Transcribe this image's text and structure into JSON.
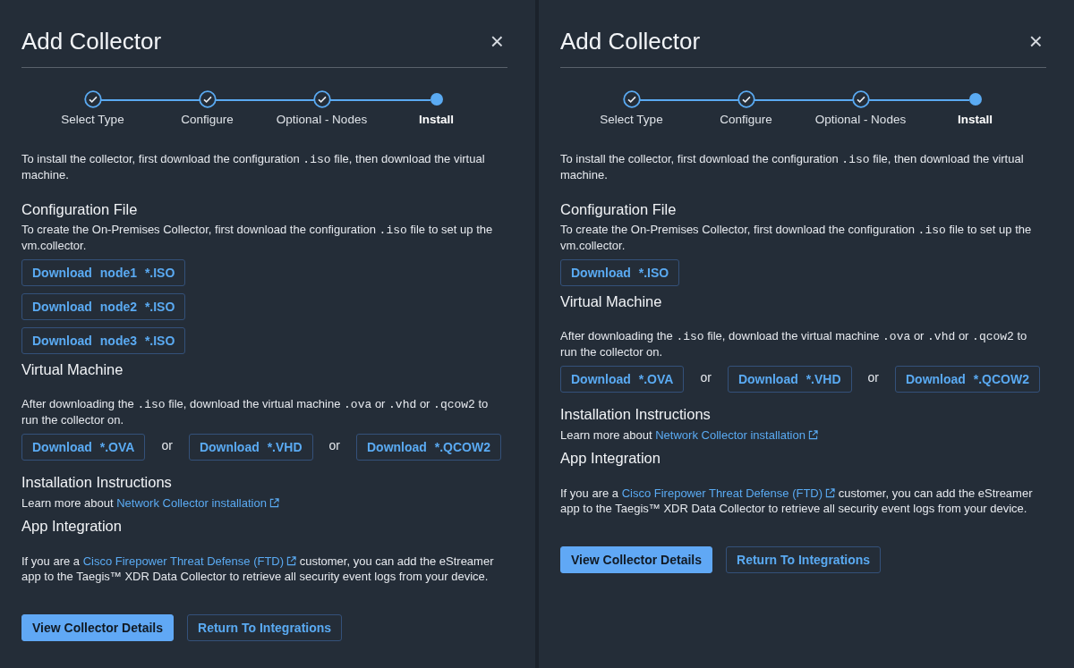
{
  "panels": [
    {
      "title": "Add Collector",
      "close": "×",
      "steps": [
        {
          "label": "Select Type",
          "completed": true,
          "selected": false
        },
        {
          "label": "Configure",
          "completed": true,
          "selected": false
        },
        {
          "label": "Optional - Nodes",
          "completed": true,
          "selected": false
        },
        {
          "label": "Install",
          "completed": false,
          "selected": true
        }
      ],
      "intro": [
        {
          "kind": "text",
          "text": "To install the collector, first download the configuration "
        },
        {
          "kind": "code",
          "text": ".iso"
        },
        {
          "kind": "text",
          "text": " file, then download the virtual machine."
        }
      ],
      "config": {
        "heading": "Configuration File",
        "text": [
          {
            "kind": "text",
            "text": "To create the On-Premises Collector, first download the configuration "
          },
          {
            "kind": "code",
            "text": ".iso"
          },
          {
            "kind": "text",
            "text": " file to set up the vm.collector."
          }
        ],
        "buttons": [
          "Download node1 *.ISO",
          "Download node2 *.ISO",
          "Download node3 *.ISO"
        ]
      },
      "vm": {
        "heading": "Virtual Machine",
        "text": [
          {
            "kind": "text",
            "text": "After downloading the "
          },
          {
            "kind": "code",
            "text": ".iso"
          },
          {
            "kind": "text",
            "text": "  file, download the virtual machine "
          },
          {
            "kind": "code",
            "text": ".ova"
          },
          {
            "kind": "text",
            "text": " or "
          },
          {
            "kind": "code",
            "text": ".vhd"
          },
          {
            "kind": "text",
            "text": " or "
          },
          {
            "kind": "code",
            "text": ".qcow2"
          },
          {
            "kind": "text",
            "text": " to run the collector on."
          }
        ],
        "items": [
          {
            "kind": "button",
            "text": "Download *.OVA"
          },
          {
            "kind": "separator",
            "text": "or"
          },
          {
            "kind": "button",
            "text": "Download *.VHD"
          },
          {
            "kind": "separator",
            "text": "or"
          },
          {
            "kind": "button",
            "text": "Download *.QCOW2"
          }
        ]
      },
      "install": {
        "heading": "Installation Instructions",
        "text": [
          {
            "kind": "text",
            "text": "Learn more about "
          },
          {
            "kind": "link",
            "text": "Network Collector installation"
          }
        ]
      },
      "app": {
        "heading": "App Integration",
        "text": [
          {
            "kind": "text",
            "text": "If you are a "
          },
          {
            "kind": "link",
            "text": "Cisco Firepower Threat Defense (FTD)"
          },
          {
            "kind": "text",
            "text": " customer, you can add the eStreamer app to the Taegis™ XDR Data Collector to retrieve all security event logs from your device."
          }
        ]
      },
      "actions": [
        {
          "kind": "primary",
          "label": "View Collector Details"
        },
        {
          "kind": "secondary",
          "label": "Return To Integrations"
        }
      ]
    },
    {
      "title": "Add Collector",
      "close": "×",
      "steps": [
        {
          "label": "Select Type",
          "completed": true,
          "selected": false
        },
        {
          "label": "Configure",
          "completed": true,
          "selected": false
        },
        {
          "label": "Optional - Nodes",
          "completed": true,
          "selected": false
        },
        {
          "label": "Install",
          "completed": false,
          "selected": true
        }
      ],
      "intro": [
        {
          "kind": "text",
          "text": "To install the collector, first download the configuration "
        },
        {
          "kind": "code",
          "text": ".iso"
        },
        {
          "kind": "text",
          "text": " file, then download the virtual machine."
        }
      ],
      "config": {
        "heading": "Configuration File",
        "text": [
          {
            "kind": "text",
            "text": "To create the On-Premises Collector, first download the configuration "
          },
          {
            "kind": "code",
            "text": ".iso"
          },
          {
            "kind": "text",
            "text": " file to set up the vm.collector."
          }
        ],
        "buttons": [
          "Download *.ISO"
        ]
      },
      "vm": {
        "heading": "Virtual Machine",
        "text": [
          {
            "kind": "text",
            "text": "After downloading the "
          },
          {
            "kind": "code",
            "text": ".iso"
          },
          {
            "kind": "text",
            "text": "  file, download the virtual machine "
          },
          {
            "kind": "code",
            "text": ".ova"
          },
          {
            "kind": "text",
            "text": " or "
          },
          {
            "kind": "code",
            "text": ".vhd"
          },
          {
            "kind": "text",
            "text": " or "
          },
          {
            "kind": "code",
            "text": ".qcow2"
          },
          {
            "kind": "text",
            "text": " to run the collector on."
          }
        ],
        "items": [
          {
            "kind": "button",
            "text": "Download *.OVA"
          },
          {
            "kind": "separator",
            "text": "or"
          },
          {
            "kind": "button",
            "text": "Download *.VHD"
          },
          {
            "kind": "separator",
            "text": "or"
          },
          {
            "kind": "button",
            "text": "Download *.QCOW2"
          }
        ]
      },
      "install": {
        "heading": "Installation Instructions",
        "text": [
          {
            "kind": "text",
            "text": "Learn more about "
          },
          {
            "kind": "link",
            "text": "Network Collector installation"
          }
        ]
      },
      "app": {
        "heading": "App Integration",
        "text": [
          {
            "kind": "text",
            "text": "If you are a "
          },
          {
            "kind": "link",
            "text": "Cisco Firepower Threat Defense (FTD)"
          },
          {
            "kind": "text",
            "text": " customer, you can add the eStreamer app to the Taegis™ XDR Data Collector to retrieve all security event logs from your device."
          }
        ]
      },
      "actions": [
        {
          "kind": "primary",
          "label": "View Collector Details"
        },
        {
          "kind": "secondary",
          "label": "Return To Integrations"
        }
      ]
    }
  ]
}
